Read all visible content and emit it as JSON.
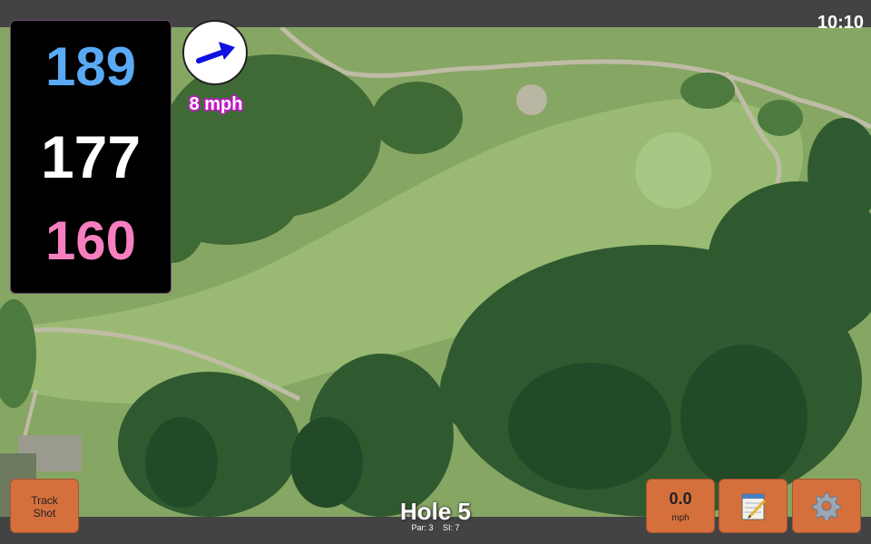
{
  "status_bar": {
    "time": "10:10"
  },
  "distances": {
    "back": "189",
    "middle": "177",
    "front": "160"
  },
  "wind": {
    "speed_label": "8 mph",
    "direction_icon": "arrow-icon"
  },
  "buttons": {
    "track_shot": {
      "line1": "Track",
      "line2": "Shot"
    },
    "shot_speed": {
      "value": "0.0",
      "unit": "mph"
    },
    "notes_icon": "notepad-icon",
    "settings_icon": "gear-icon"
  },
  "hole": {
    "title": "Hole 5",
    "par_label": "Par: 3",
    "si_label": "SI: 7"
  },
  "colors": {
    "back_distance": "#5aa9f4",
    "front_distance": "#f77fc0",
    "button": "#d5703d",
    "wind_outline": "#c218c4"
  }
}
